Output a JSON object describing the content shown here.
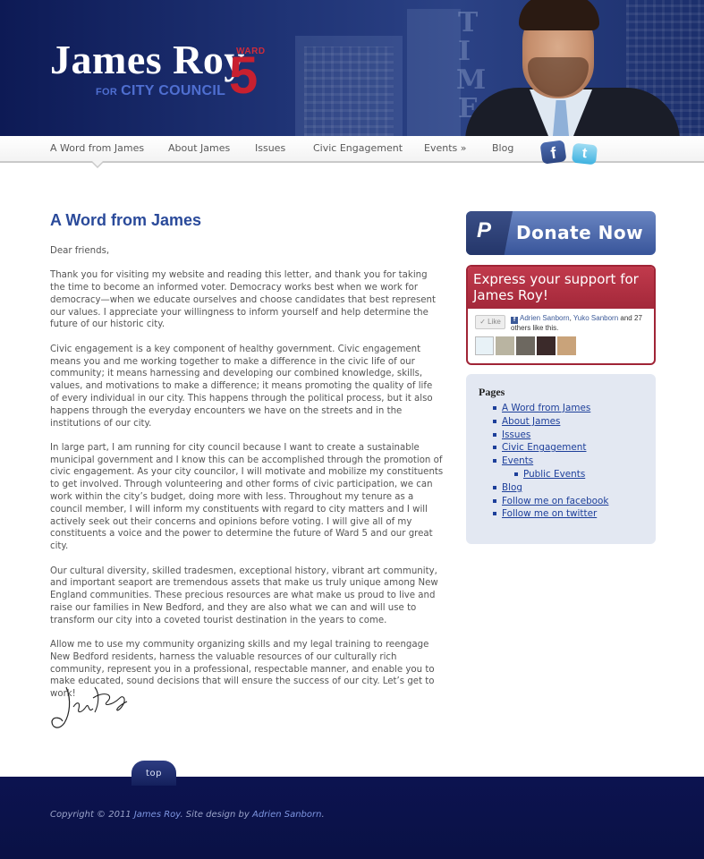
{
  "header": {
    "logo_name": "James Roy",
    "logo_for": "FOR",
    "logo_office": "CITY COUNCIL",
    "logo_ward": "WARD",
    "logo_ward_number": "5",
    "accent_blue": "#2a4a9a",
    "accent_red": "#c8202f"
  },
  "nav": {
    "items": [
      {
        "label": "A Word from James",
        "active": true
      },
      {
        "label": "About James"
      },
      {
        "label": "Issues"
      },
      {
        "label": "Civic Engagement"
      },
      {
        "label": "Events »"
      },
      {
        "label": "Blog"
      }
    ],
    "social": [
      {
        "icon": "facebook-icon",
        "glyph": "f"
      },
      {
        "icon": "twitter-icon",
        "glyph": "t"
      }
    ]
  },
  "main": {
    "title": "A Word from James",
    "paragraphs": [
      "Dear friends,",
      "Thank you for visiting my website and reading this letter, and thank you for taking the time to become an informed voter. Democracy works best when we work for democracy—when we educate ourselves and choose candidates that best represent our values. I appreciate your willingness to inform yourself and help determine the future of our historic city.",
      "Civic engagement is a key component of healthy government. Civic engagement means you and me working together to make a difference in the civic life of our community; it means harnessing and developing our combined knowledge, skills, values, and motivations to make a difference; it means promoting the quality of life of every individual in our city. This happens through the political process, but it also happens through the everyday encounters we have on the streets and in the institutions of our city.",
      "In large part, I am running for city council because I want to create a sustainable municipal government and I know this can be accomplished through the promotion of civic engagement. As your city councilor, I will motivate and mobilize my constituents to get involved. Through volunteering and other forms of civic participation, we can work within the city’s budget, doing more with less. Throughout my tenure as a council member, I will inform my constituents with regard to city matters and I will actively seek out their concerns and opinions before voting. I will give all of my constituents a voice and the power to determine the future of Ward 5 and our great city.",
      "Our cultural diversity, skilled tradesmen, exceptional history, vibrant art community, and important seaport are tremendous assets that make us truly unique among New England communities. These precious resources are what make us proud to live and raise our families in New Bedford, and they are also what we can and will use to transform our city into a coveted tourist destination in the years to come.",
      "Allow me to use my community organizing skills and my legal training to reengage New Bedford residents, harness the valuable resources of our culturally rich community, represent you in a professional, respectable manner, and enable you to make educated, sound decisions that will ensure the success of our city. Let’s get to work!"
    ]
  },
  "sidebar": {
    "donate": {
      "icon": "paypal-icon",
      "glyph": "P",
      "label": "Donate Now"
    },
    "support": {
      "heading": "Express your support for James Roy!",
      "like_label": "Like",
      "like_names": [
        "Adrien Sanborn",
        "Yuko Sanborn"
      ],
      "like_and": "and",
      "like_rest": "27 others like this.",
      "face_colors": [
        "#e8f2f7",
        "#b9b4a1",
        "#6d6860",
        "#3b2a2a",
        "#c9a37a"
      ]
    },
    "pages": {
      "title": "Pages",
      "items": [
        {
          "label": "A Word from James"
        },
        {
          "label": "About James"
        },
        {
          "label": "Issues"
        },
        {
          "label": "Civic Engagement"
        },
        {
          "label": "Events"
        },
        {
          "label": "Public Events",
          "sub": true
        },
        {
          "label": "Blog"
        },
        {
          "label": "Follow me on facebook"
        },
        {
          "label": "Follow me on twitter"
        }
      ]
    }
  },
  "footer": {
    "top_label": "top",
    "copyright_prefix": "Copyright © 2011",
    "owner": "James Roy",
    "design_prefix": ".  Site design by",
    "designer": "Adrien Sanborn",
    "end": "."
  }
}
